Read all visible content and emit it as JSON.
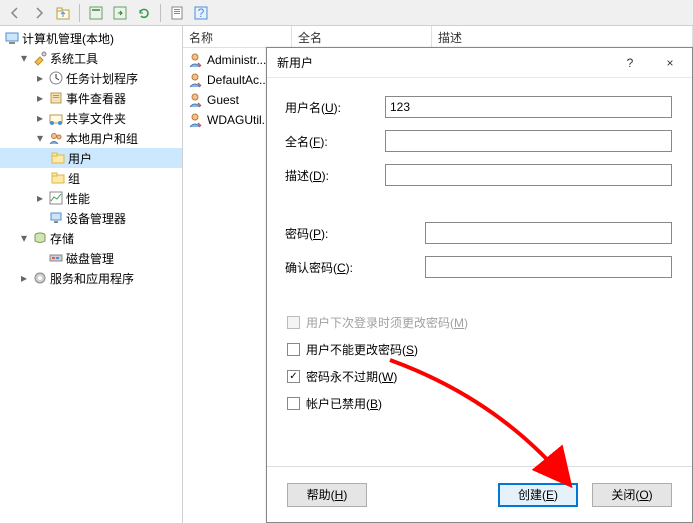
{
  "toolbar_icons": [
    "back",
    "forward",
    "up",
    "divider",
    "show-hide",
    "export",
    "refresh",
    "divider",
    "properties",
    "help"
  ],
  "tree": {
    "root": "计算机管理(本地)",
    "system_tools": "系统工具",
    "task_scheduler": "任务计划程序",
    "event_viewer": "事件查看器",
    "shared_folders": "共享文件夹",
    "local_users": "本地用户和组",
    "users": "用户",
    "groups": "组",
    "performance": "性能",
    "device_manager": "设备管理器",
    "storage": "存储",
    "disk_management": "磁盘管理",
    "services": "服务和应用程序"
  },
  "list": {
    "col_name": "名称",
    "col_fullname": "全名",
    "col_desc": "描述",
    "rows": [
      "Administr...",
      "DefaultAc...",
      "Guest",
      "WDAGUtil..."
    ]
  },
  "dialog": {
    "title": "新用户",
    "help": "?",
    "close": "×",
    "username_label": "用户名(U):",
    "username_value": "123",
    "fullname_label": "全名(F):",
    "fullname_value": "",
    "desc_label": "描述(D):",
    "desc_value": "",
    "password_label": "密码(P):",
    "password_value": "",
    "confirm_label": "确认密码(C):",
    "confirm_value": "",
    "cb_must_change": "用户下次登录时须更改密码(M)",
    "cb_cannot_change": "用户不能更改密码(S)",
    "cb_never_expire": "密码永不过期(W)",
    "cb_disabled": "帐户已禁用(B)",
    "btn_help": "帮助(H)",
    "btn_create": "创建(E)",
    "btn_close": "关闭(O)"
  }
}
